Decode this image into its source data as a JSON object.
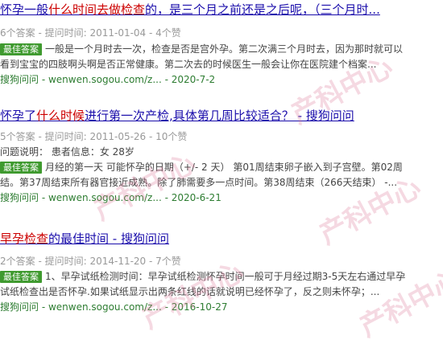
{
  "results": [
    {
      "title_parts": [
        "怀孕一般",
        "什么时间去做检查",
        "的，是三个月之前还是之后呢，（三个月时..."
      ],
      "meta": "6个答案 - 提问时间: 2011-01-04 - 4个赞",
      "badge": "最佳答案",
      "body_lines": [
        "一般是一个月时去一次，检查是否是宫外孕。第二次满三个月时去，因为那时就可以",
        "看到宝宝的四肢啊头啊是否正常健康。第二次去的时候医生一般会让你在医院建个档案..."
      ],
      "url": "搜狗问问 - wenwen.sogou.com/z... - 2020-7-2"
    },
    {
      "title_parts": [
        "怀孕了",
        "什么时候",
        "进行第一次产检,具体第几周比较适合？ - 搜狗问问"
      ],
      "meta": "5个答案 - 提问时间: 2011-05-26 - 10个赞",
      "desc": "问题说明： 患者信息：女 28岁",
      "badge": "最佳答案",
      "body_lines": [
        "月经的第一天 可能怀孕的日期（+/- 2 天） 第01周结束卵子嵌入到子宫壁。第02周",
        "结。第37周结束所有器官接近成熟。除了肺需要多一点时间。第38周结束（266天结束） -..."
      ],
      "url": "搜狗问问 - wenwen.sogou.com/z... - 2020-6-21"
    },
    {
      "title_parts": [
        "早孕检查",
        "的最佳时间",
        " - 搜狗问问"
      ],
      "meta": "2个答案 - 提问时间: 2014-11-20 - 7个赞",
      "badge": "最佳答案",
      "body_lines": [
        "1、早孕试纸检测时间：早孕试纸检测怀孕时间一般可于月经过期3-5天左右通过早孕",
        "试纸检查出是否怀孕.如果试纸显示出两条红线的话就说明已经怀孕了，反之则未怀孕；..."
      ],
      "url": "搜狗问问 - wenwen.sogou.com/z... - 2016-10-27"
    }
  ],
  "watermark": "产科中心",
  "colors": {
    "link": "#1a0dab",
    "highlight": "#cc0000",
    "badge": "#3f9a2f",
    "url": "#2e7d32",
    "meta": "#999999"
  }
}
